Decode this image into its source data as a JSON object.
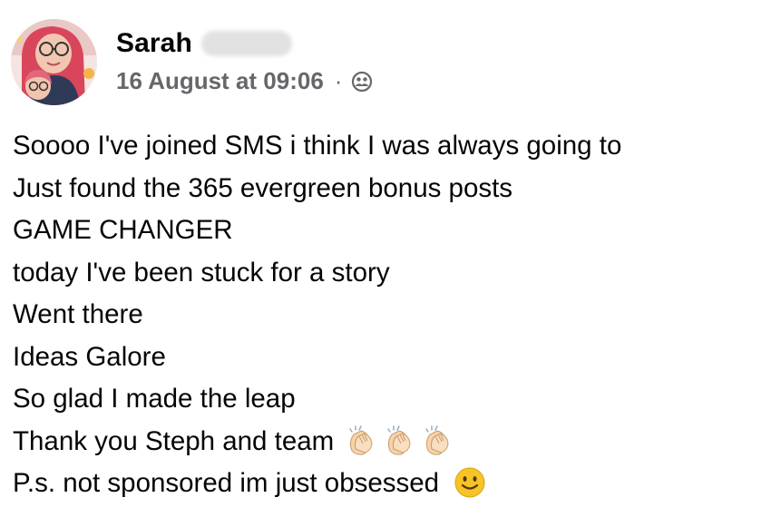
{
  "post": {
    "author": {
      "name": "Sarah"
    },
    "timestamp": "16 August at 09:06",
    "meta_separator": "·",
    "audience_icon": "friends-icon",
    "lines": [
      "Soooo I've joined SMS i think I was always going to",
      "Just found the 365 evergreen bonus posts",
      "GAME CHANGER",
      "today I've been stuck for a story",
      "Went there",
      "Ideas Galore",
      "So glad I made the leap",
      "Thank you Steph and team",
      "P.s. not sponsored im just obsessed"
    ],
    "line_8_emoji": [
      "clapping-hands-emoji",
      "clapping-hands-emoji",
      "clapping-hands-emoji"
    ],
    "line_9_emoji": "smiling-face-emoji"
  },
  "colors": {
    "text": "#050505",
    "meta_text": "#65676b",
    "emoji_skin": "#f6d3a8",
    "emoji_face": "#f7c325",
    "avatar_hair": "#d9465b"
  }
}
